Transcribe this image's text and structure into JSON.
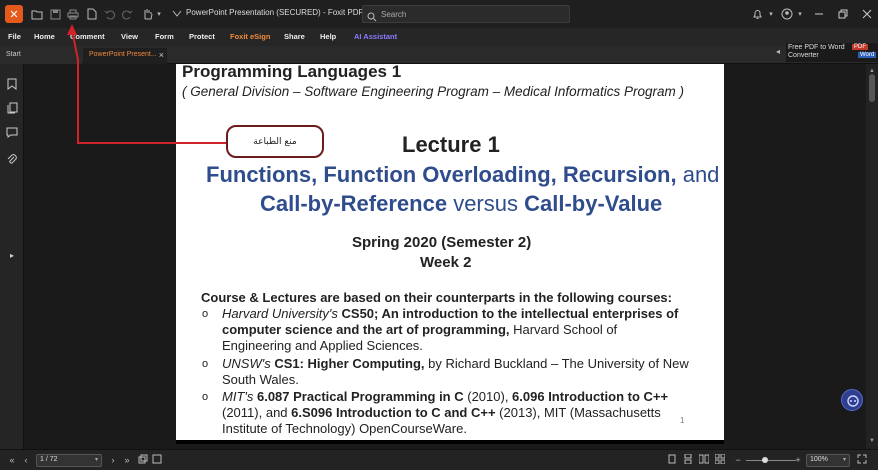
{
  "window": {
    "title": "PowerPoint Presentation (SECURED) - Foxit PDF Reader",
    "search_placeholder": "Search"
  },
  "menu": {
    "items": [
      "File",
      "Home",
      "Comment",
      "View",
      "Form",
      "Protect",
      "Foxit eSign",
      "Share",
      "Help",
      "AI Assistant"
    ],
    "accent_esign": "#f08a3c",
    "accent_ai": "#8a7cff"
  },
  "tabs": {
    "start": "Start",
    "doc": "PowerPoint Present...",
    "doc_close": "×"
  },
  "banner": {
    "line1": "Free PDF to Word",
    "line2": "Converter",
    "pdf_badge": "PDF",
    "word_badge": "Word"
  },
  "annotation": {
    "text": "منع الطباعة",
    "color": "#d0232a"
  },
  "page": {
    "course_title": "Programming Languages 1",
    "subtitle": "( General Division – Software Engineering Program – Medical Informatics Program )",
    "lecture": "Lecture 1",
    "topic_line1_a": "Functions, Function Overloading, Recursion,",
    "topic_line1_b": " and",
    "topic_line2_a": "Call-by-Reference",
    "topic_line2_b": " versus ",
    "topic_line2_c": "Call-by-Value",
    "semester": "Spring 2020 (Semester 2)",
    "week": "Week 2",
    "courses_heading": "Course & Lectures are based on their counterparts in the following courses:",
    "bullet_marker": "o",
    "b1_l1_a": "Harvard University's",
    "b1_l1_b": " CS50; An introduction to the intellectual enterprises of",
    "b1_l2_a": "computer science and the art of programming,",
    "b1_l2_b": " Harvard School of",
    "b1_l3": "Engineering and Applied Sciences.",
    "b2_l1_a": "UNSW's",
    "b2_l1_b": " CS1: Higher Computing,",
    "b2_l1_c": " by Richard Buckland – The University of New",
    "b2_l2": "South Wales.",
    "b3_l1_a": "MIT's",
    "b3_l1_b": " 6.087 Practical Programming in C",
    "b3_l1_c": " (2010), ",
    "b3_l1_d": "6.096 Introduction to C++",
    "b3_l2_a": "(2011), and ",
    "b3_l2_b": "6.S096 Introduction to C and C++",
    "b3_l2_c": " (2013), MIT (Massachusetts",
    "b3_l3": "Institute of Technology) OpenCourseWare.",
    "page_number": "1"
  },
  "status": {
    "page_indicator": "1 / 72",
    "zoom": "100%"
  },
  "colors": {
    "blue": "#2f4c8c",
    "orange": "#d77a14",
    "foxit_orange": "#e45a1c"
  }
}
